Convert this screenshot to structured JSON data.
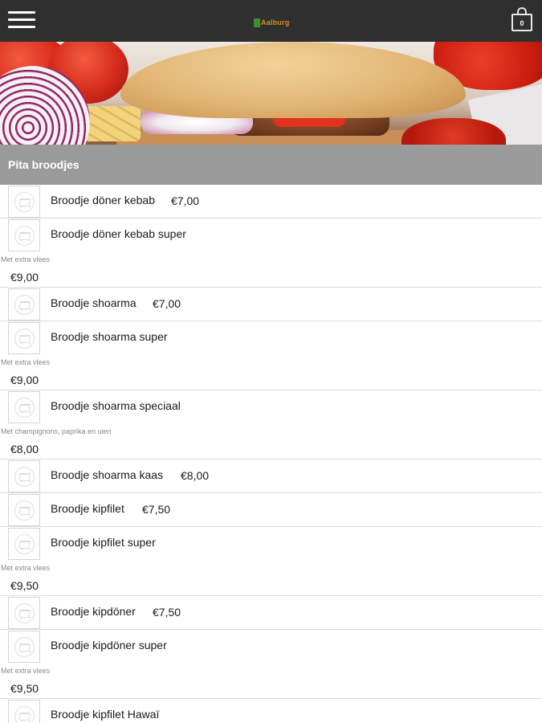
{
  "header": {
    "menu_icon": "hamburger-menu-icon",
    "logo_text": "Aalburg",
    "cart_icon": "shopping-bag-icon",
    "cart_count": "0"
  },
  "hero": {
    "image": "doner-kebab-pita-photo"
  },
  "category": {
    "title": "Pita broodjes"
  },
  "colors": {
    "topbar": "#2f2f2f",
    "category_bar": "#9b9b9b",
    "logo_accent": "#d98a1e",
    "logo_mark": "#3e8e2c"
  },
  "items": [
    {
      "name": "Broodje döner kebab",
      "price": "€7,00",
      "description": ""
    },
    {
      "name": "Broodje döner kebab super",
      "price": "€9,00",
      "description": "Met extra vlees"
    },
    {
      "name": "Broodje shoarma",
      "price": "€7,00",
      "description": ""
    },
    {
      "name": "Broodje shoarma super",
      "price": "€9,00",
      "description": "Met extra vlees"
    },
    {
      "name": "Broodje shoarma speciaal",
      "price": "€8,00",
      "description": "Met champignons, paprika en uien"
    },
    {
      "name": "Broodje shoarma kaas",
      "price": "€8,00",
      "description": ""
    },
    {
      "name": "Broodje kipfilet",
      "price": "€7,50",
      "description": ""
    },
    {
      "name": "Broodje kipfilet super",
      "price": "€9,50",
      "description": "Met extra vlees"
    },
    {
      "name": "Broodje kipdöner",
      "price": "€7,50",
      "description": ""
    },
    {
      "name": "Broodje kipdöner super",
      "price": "€9,50",
      "description": "Met extra vlees"
    },
    {
      "name": "Broodje kipfilet Hawaï",
      "price": "",
      "description": ""
    }
  ]
}
